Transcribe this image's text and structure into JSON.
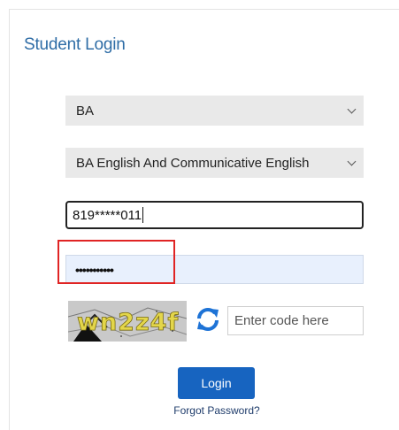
{
  "login": {
    "title": "Student Login",
    "course_select": {
      "value": "BA"
    },
    "subject_select": {
      "value": "BA English And Communicative English"
    },
    "mobile_input": {
      "value": "819*****011"
    },
    "password_input": {
      "value": "•••••••••••"
    },
    "captcha": {
      "text": "wn2z4f"
    },
    "captcha_input": {
      "placeholder": "Enter code here"
    },
    "login_button": {
      "label": "Login"
    },
    "forgot_link": {
      "label": "Forgot Password?"
    }
  },
  "colors": {
    "title": "#2f6da6",
    "button": "#1764c0",
    "highlight": "#e02424",
    "password_bg": "#e8f0fd",
    "refresh_icon": "#1e73d6"
  },
  "icons": {
    "refresh": "refresh-icon",
    "chevron": "chevron-down-icon"
  }
}
